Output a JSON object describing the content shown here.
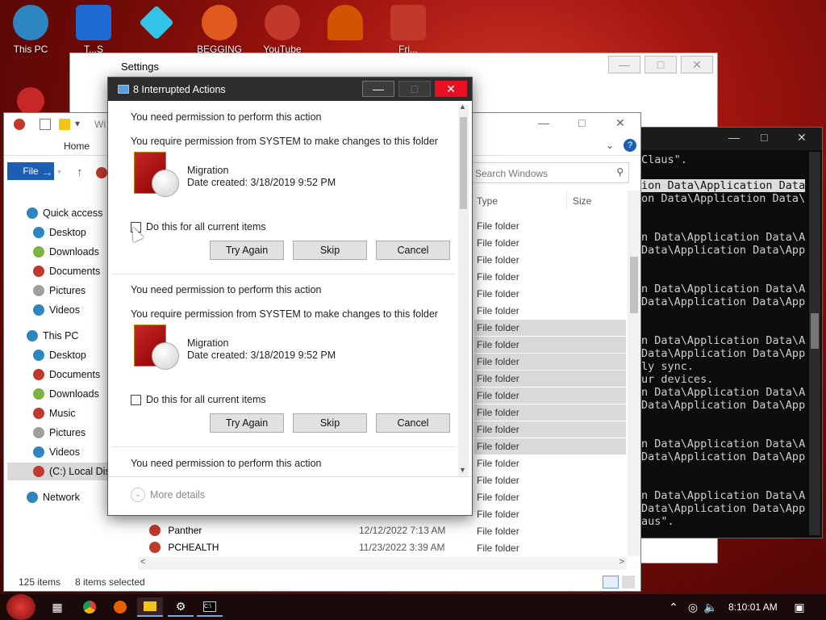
{
  "desktop": {
    "icons": [
      {
        "label": "This PC",
        "color": "#2e86c1"
      },
      {
        "label": "T...S",
        "color": "#1e6bd6"
      },
      {
        "label": "",
        "color": "#33c3e6"
      },
      {
        "label": "BEGGING LOL",
        "color": "#e05a1f"
      },
      {
        "label": "YouTube",
        "color": "#c0392b"
      },
      {
        "label": "",
        "color": "#d35400"
      },
      {
        "label": "Fri...",
        "color": "#c0392b"
      }
    ]
  },
  "settings": {
    "title": "Settings"
  },
  "terminal": {
    "lines": [
      "Claus\".",
      "",
      "ion Data\\Application Data",
      "on Data\\Application Data\\",
      "",
      "",
      "n Data\\Application Data\\Ap",
      "Data\\Application Data\\App",
      "",
      "",
      "n Data\\Application Data\\Ap",
      "Data\\Application Data\\App",
      "",
      "",
      "n Data\\Application Data\\Ap",
      "Data\\Application Data\\App",
      "ly sync.",
      "ur devices.",
      "n Data\\Application Data\\Ap",
      "Data\\Application Data\\App",
      "",
      "",
      "n Data\\Application Data\\Ap",
      "Data\\Application Data\\App",
      "",
      "",
      "n Data\\Application Data\\Ap",
      "Data\\Application Data\\App",
      "aus\"."
    ]
  },
  "explorer": {
    "title": "Wi",
    "tabs": {
      "file": "File",
      "home": "Home"
    },
    "search_placeholder": "Search Windows",
    "columns": {
      "type": "Type",
      "size": "Size"
    },
    "nav": [
      {
        "label": "Quick access",
        "color": "#2e86c1",
        "indent": 0
      },
      {
        "label": "Desktop",
        "color": "#2e86c1",
        "indent": 1
      },
      {
        "label": "Downloads",
        "color": "#7cb342",
        "indent": 1
      },
      {
        "label": "Documents",
        "color": "#c0392b",
        "indent": 1
      },
      {
        "label": "Pictures",
        "color": "#9e9e9e",
        "indent": 1
      },
      {
        "label": "Videos",
        "color": "#2e86c1",
        "indent": 1
      },
      {
        "label": "This PC",
        "color": "#2e86c1",
        "indent": 0
      },
      {
        "label": "Desktop",
        "color": "#2e86c1",
        "indent": 1
      },
      {
        "label": "Documents",
        "color": "#c0392b",
        "indent": 1
      },
      {
        "label": "Downloads",
        "color": "#7cb342",
        "indent": 1
      },
      {
        "label": "Music",
        "color": "#c0392b",
        "indent": 1
      },
      {
        "label": "Pictures",
        "color": "#9e9e9e",
        "indent": 1
      },
      {
        "label": "Videos",
        "color": "#2e86c1",
        "indent": 1
      },
      {
        "label": "(C:) Local Disk",
        "color": "#c0392b",
        "indent": 1
      },
      {
        "label": "Network",
        "color": "#2e86c1",
        "indent": 0
      }
    ],
    "types": [
      {
        "label": "File folder",
        "selected": false
      },
      {
        "label": "File folder",
        "selected": false
      },
      {
        "label": "File folder",
        "selected": false
      },
      {
        "label": "File folder",
        "selected": false
      },
      {
        "label": "File folder",
        "selected": false
      },
      {
        "label": "File folder",
        "selected": false
      },
      {
        "label": "File folder",
        "selected": true
      },
      {
        "label": "File folder",
        "selected": true
      },
      {
        "label": "File folder",
        "selected": true
      },
      {
        "label": "File folder",
        "selected": true
      },
      {
        "label": "File folder",
        "selected": true
      },
      {
        "label": "File folder",
        "selected": true
      },
      {
        "label": "File folder",
        "selected": true
      },
      {
        "label": "File folder",
        "selected": true
      },
      {
        "label": "File folder",
        "selected": false
      },
      {
        "label": "File folder",
        "selected": false
      },
      {
        "label": "File folder",
        "selected": false
      },
      {
        "label": "File folder",
        "selected": false
      },
      {
        "label": "File folder",
        "selected": false
      },
      {
        "label": "File folder",
        "selected": false
      }
    ],
    "bottom_rows": [
      {
        "name": "Panther",
        "date": "12/12/2022 7:13 AM"
      },
      {
        "name": "PCHEALTH",
        "date": "11/23/2022 3:39 AM"
      }
    ],
    "status": {
      "items": "125 items",
      "selected": "8 items selected"
    }
  },
  "dialog": {
    "title": "8 Interrupted Actions",
    "sections": [
      {
        "heading": "You need permission to perform this action",
        "sub": "You require permission from SYSTEM to make changes to this folder",
        "name": "Migration",
        "date": "Date created: 3/18/2019 9:52 PM",
        "checkbox": "Do this for all current items",
        "try_again": "Try Again",
        "skip": "Skip",
        "cancel": "Cancel"
      },
      {
        "heading": "You need permission to perform this action",
        "sub": "You require permission from SYSTEM to make changes to this folder",
        "name": "Migration",
        "date": "Date created: 3/18/2019 9:52 PM",
        "checkbox": "Do this for all current items",
        "try_again": "Try Again",
        "skip": "Skip",
        "cancel": "Cancel"
      }
    ],
    "third_heading": "You need permission to perform this action",
    "more_details": "More details"
  },
  "taskbar": {
    "time": "8:10:01 AM"
  },
  "colors": {
    "accent": "#1a5fb4",
    "close": "#e81123"
  }
}
